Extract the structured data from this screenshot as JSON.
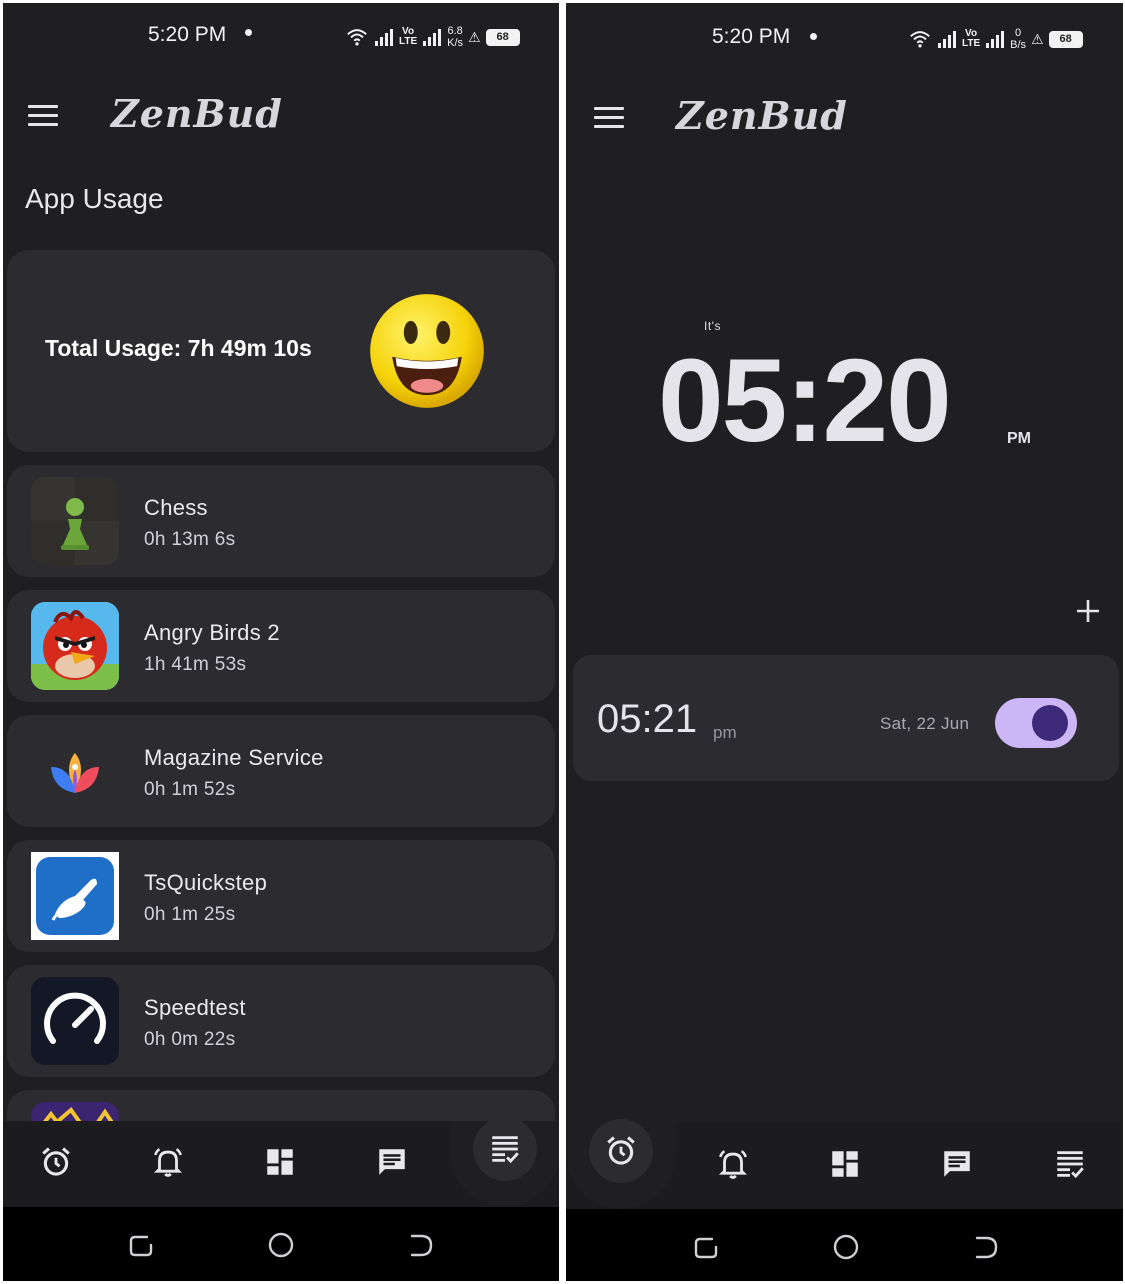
{
  "left_screen": {
    "status": {
      "time": "5:20 PM",
      "speed_top": "6.8",
      "speed_bottom": "K/s",
      "lte_top": "Vo",
      "lte_bottom": "LTE",
      "battery": "68"
    },
    "app_name": "ZenBud",
    "section_title": "App Usage",
    "total_usage": "Total Usage: 7h 49m 10s",
    "apps": [
      {
        "name": "Chess",
        "time": "0h 13m 6s",
        "icon": "chess-pawn-icon"
      },
      {
        "name": "Angry Birds 2",
        "time": "1h 41m 53s",
        "icon": "angry-bird-icon"
      },
      {
        "name": "Magazine Service",
        "time": "0h 1m 52s",
        "icon": "lotus-icon"
      },
      {
        "name": "TsQuickstep",
        "time": "0h 1m 25s",
        "icon": "hand-icon"
      },
      {
        "name": "Speedtest",
        "time": "0h 0m 22s",
        "icon": "speedometer-icon"
      }
    ],
    "nav": {
      "items": [
        "alarm-clock-icon",
        "alarm-bell-icon",
        "dashboard-icon",
        "message-icon",
        "list-check-icon"
      ],
      "selected": "list-check-icon"
    }
  },
  "right_screen": {
    "status": {
      "time": "5:20 PM",
      "speed_top": "0",
      "speed_bottom": "B/s",
      "lte_top": "Vo",
      "lte_bottom": "LTE",
      "battery": "68"
    },
    "app_name": "ZenBud",
    "clock_prefix": "It's",
    "clock_time": "05:20",
    "clock_ampm": "PM",
    "alarm": {
      "time": "05:21",
      "ampm": "pm",
      "date": "Sat, 22 Jun",
      "enabled": true
    },
    "nav": {
      "items": [
        "alarm-clock-icon",
        "alarm-bell-icon",
        "dashboard-icon",
        "message-icon",
        "list-check-icon"
      ],
      "selected": "alarm-clock-icon"
    }
  },
  "colors": {
    "background": "#1f1f22",
    "card": "#2b2b30",
    "toggle_track": "#cdb6f6",
    "toggle_knob": "#3d2a7a"
  }
}
